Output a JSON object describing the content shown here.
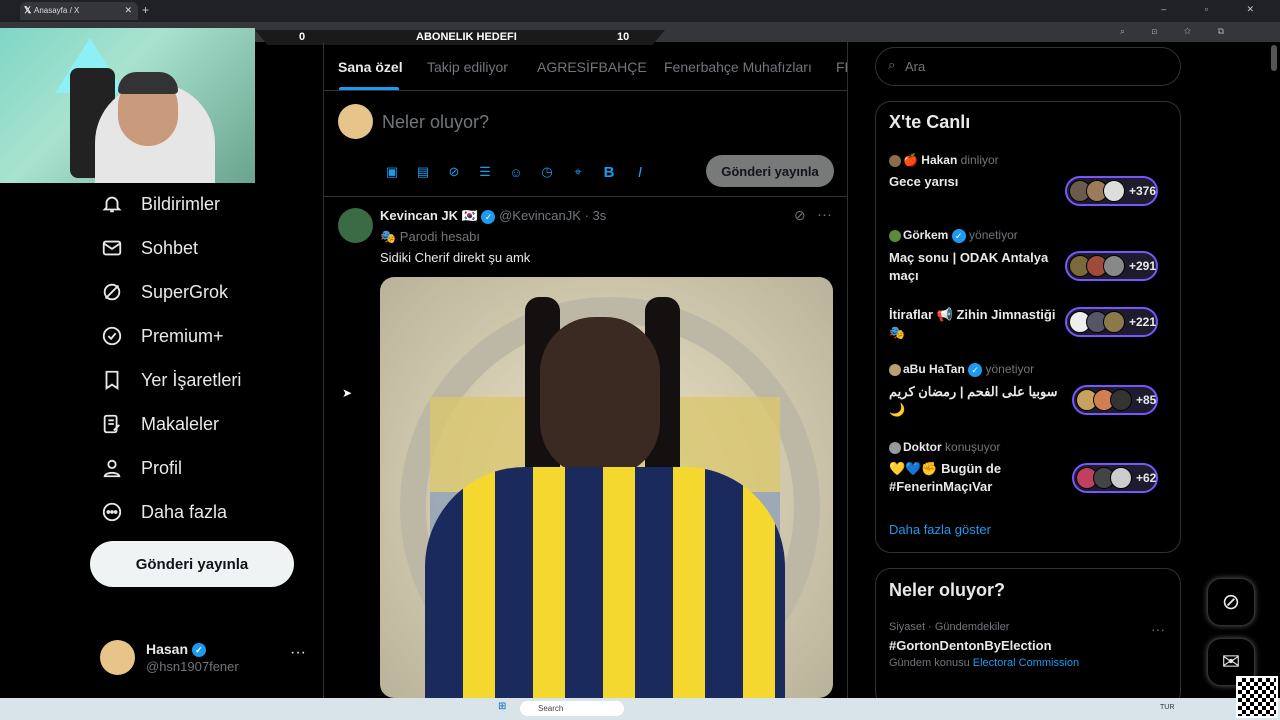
{
  "browser": {
    "tab_title": "Anasayfa / X",
    "new_tab": "+",
    "window_controls": "– ▫ ✕"
  },
  "stream_overlay": {
    "left_value": "0",
    "title": "ABONELIK HEDEFI",
    "right_value": "10"
  },
  "nav": {
    "items": [
      {
        "label": "Bildirimler",
        "icon": "bell-icon"
      },
      {
        "label": "Sohbet",
        "icon": "mail-icon"
      },
      {
        "label": "SuperGrok",
        "icon": "grok-icon"
      },
      {
        "label": "Premium+",
        "icon": "verified-badge-icon"
      },
      {
        "label": "Yer İşaretleri",
        "icon": "bookmark-icon"
      },
      {
        "label": "Makaleler",
        "icon": "article-icon"
      },
      {
        "label": "Profil",
        "icon": "person-icon"
      },
      {
        "label": "Daha fazla",
        "icon": "more-circle-icon"
      }
    ],
    "post_button": "Gönderi yayınla",
    "account": {
      "name": "Hasan",
      "handle": "@hsn1907fener",
      "more": "···"
    }
  },
  "timeline": {
    "tabs": [
      "Sana özel",
      "Takip ediliyor",
      "AGRESİFBAHÇE",
      "Fenerbahçe Muhafızları",
      "FE"
    ],
    "active_tab": 0,
    "compose": {
      "placeholder": "Neler oluyor?",
      "button": "Gönderi yayınla"
    },
    "tweet": {
      "name": "Kevincan JK 🇰🇷",
      "handle": "@KevincanJK",
      "time": "· 3s",
      "parody": "🎭 Parodi hesabı",
      "text": "Sidiki Cherif direkt şu amk"
    }
  },
  "sidebar": {
    "search_placeholder": "Ara",
    "live": {
      "title": "X'te Canlı",
      "spaces": [
        {
          "host": "🍎 Hakan",
          "verified": false,
          "role": "dinliyor",
          "title": "Gece yarısı",
          "count": "+376"
        },
        {
          "host": "Görkem",
          "verified": true,
          "role": "yönetiyor",
          "title": "Maç sonu | ODAK Antalya maçı",
          "count": "+291"
        },
        {
          "host": "",
          "verified": false,
          "role": "",
          "title": "İtiraflar 📢 Zihin Jimnastiği 🎭",
          "count": "+221"
        },
        {
          "host": "aBu HaTan",
          "verified": true,
          "role": "yönetiyor",
          "title": "سوبيا على الفحم | رمضان كريم 🌙",
          "count": "+85"
        },
        {
          "host": "Doktor",
          "verified": false,
          "role": "konuşuyor",
          "title": "💛💙✊ Bugün de #FenerinMaçıVar",
          "count": "+62"
        }
      ],
      "show_more": "Daha fazla göster"
    },
    "trends": {
      "title": "Neler oluyor?",
      "category": "Siyaset · Gündemdekiler",
      "name": "#GortonDentonByElection",
      "sub_prefix": "Gündem konusu",
      "sub_link": "Electoral Commission",
      "more": "···"
    }
  },
  "taskbar": {
    "search": "Search",
    "lang": "TUR"
  },
  "colors": {
    "accent": "#1d9bf0",
    "spaces_border": "#7856ff",
    "background": "#000000"
  }
}
